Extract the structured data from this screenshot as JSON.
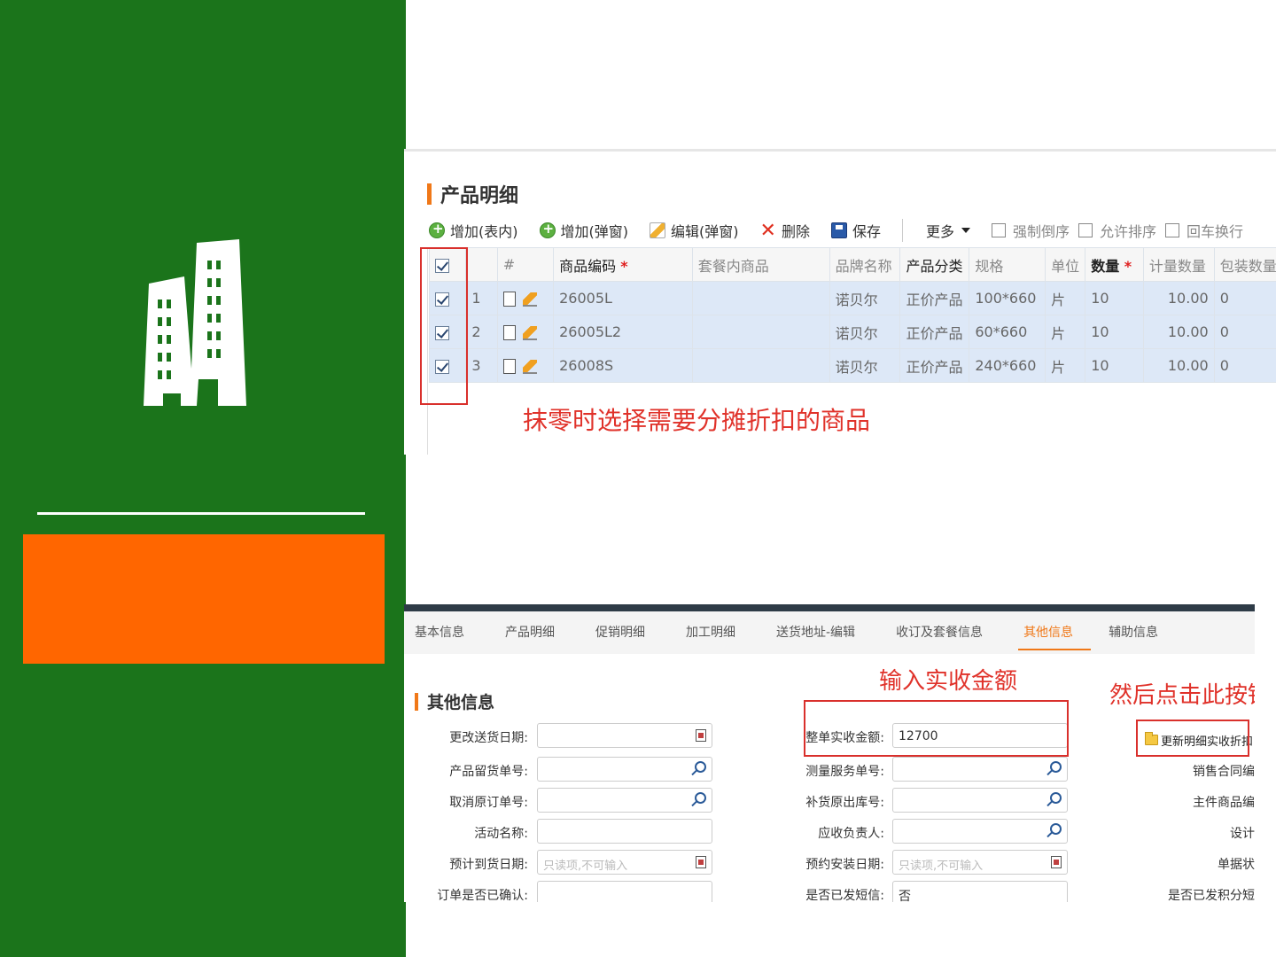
{
  "product_panel": {
    "title": "产品明细",
    "toolbar": {
      "add_inline": "增加(表内)",
      "add_popup": "增加(弹窗)",
      "edit_popup": "编辑(弹窗)",
      "delete": "删除",
      "save": "保存",
      "more": "更多",
      "force_reverse": "强制倒序",
      "allow_sort": "允许排序",
      "enter_newline": "回车换行"
    },
    "columns": [
      "#",
      "商品编码",
      "套餐内商品",
      "品牌名称",
      "产品分类",
      "规格",
      "单位",
      "数量",
      "计量数量",
      "包装数量"
    ],
    "required_mark": "*",
    "rows": [
      {
        "idx": "1",
        "code": "26005L",
        "combo": "",
        "brand": "诺贝尔",
        "category": "正价产品",
        "spec": "100*660",
        "unit": "片",
        "qty": "10",
        "measure_qty": "10.00",
        "pack_qty": "0"
      },
      {
        "idx": "2",
        "code": "26005L2",
        "combo": "",
        "brand": "诺贝尔",
        "category": "正价产品",
        "spec": "60*660",
        "unit": "片",
        "qty": "10",
        "measure_qty": "10.00",
        "pack_qty": "0"
      },
      {
        "idx": "3",
        "code": "26008S",
        "combo": "",
        "brand": "诺贝尔",
        "category": "正价产品",
        "spec": "240*660",
        "unit": "片",
        "qty": "10",
        "measure_qty": "10.00",
        "pack_qty": "0"
      }
    ],
    "annotation": "抹零时选择需要分摊折扣的商品"
  },
  "other_panel": {
    "tabs": [
      "基本信息",
      "产品明细",
      "促销明细",
      "加工明细",
      "送货地址-编辑",
      "收订及套餐信息",
      "其他信息",
      "辅助信息"
    ],
    "active_tab": "其他信息",
    "title": "其他信息",
    "annotation_amount": "输入实收金额",
    "annotation_button": "然后点击此按钮",
    "update_button": "更新明细实收折扣",
    "fields_left": [
      {
        "label": "更改送货日期:",
        "value": "",
        "placeholder": ""
      },
      {
        "label": "产品留货单号:",
        "value": "",
        "placeholder": ""
      },
      {
        "label": "取消原订单号:",
        "value": "",
        "placeholder": ""
      },
      {
        "label": "活动名称:",
        "value": "",
        "placeholder": ""
      },
      {
        "label": "预计到货日期:",
        "value": "",
        "placeholder": "只读项,不可输入"
      },
      {
        "label": "订单是否已确认:",
        "value": "",
        "placeholder": ""
      }
    ],
    "fields_mid": [
      {
        "label": "整单实收金额:",
        "value": "12700",
        "placeholder": ""
      },
      {
        "label": "测量服务单号:",
        "value": "",
        "placeholder": ""
      },
      {
        "label": "补货原出库号:",
        "value": "",
        "placeholder": ""
      },
      {
        "label": "应收负责人:",
        "value": "",
        "placeholder": ""
      },
      {
        "label": "预约安装日期:",
        "value": "",
        "placeholder": "只读项,不可输入"
      },
      {
        "label": "是否已发短信:",
        "value": "否",
        "placeholder": ""
      }
    ],
    "labels_right": [
      "销售合同编",
      "主件商品编",
      "设计",
      "单据状",
      "是否已发积分短"
    ]
  },
  "colors": {
    "side_green": "#1b741b",
    "orange_block": "#ff6600",
    "annotation_red": "#e0322a",
    "accent_orange": "#f07818"
  }
}
